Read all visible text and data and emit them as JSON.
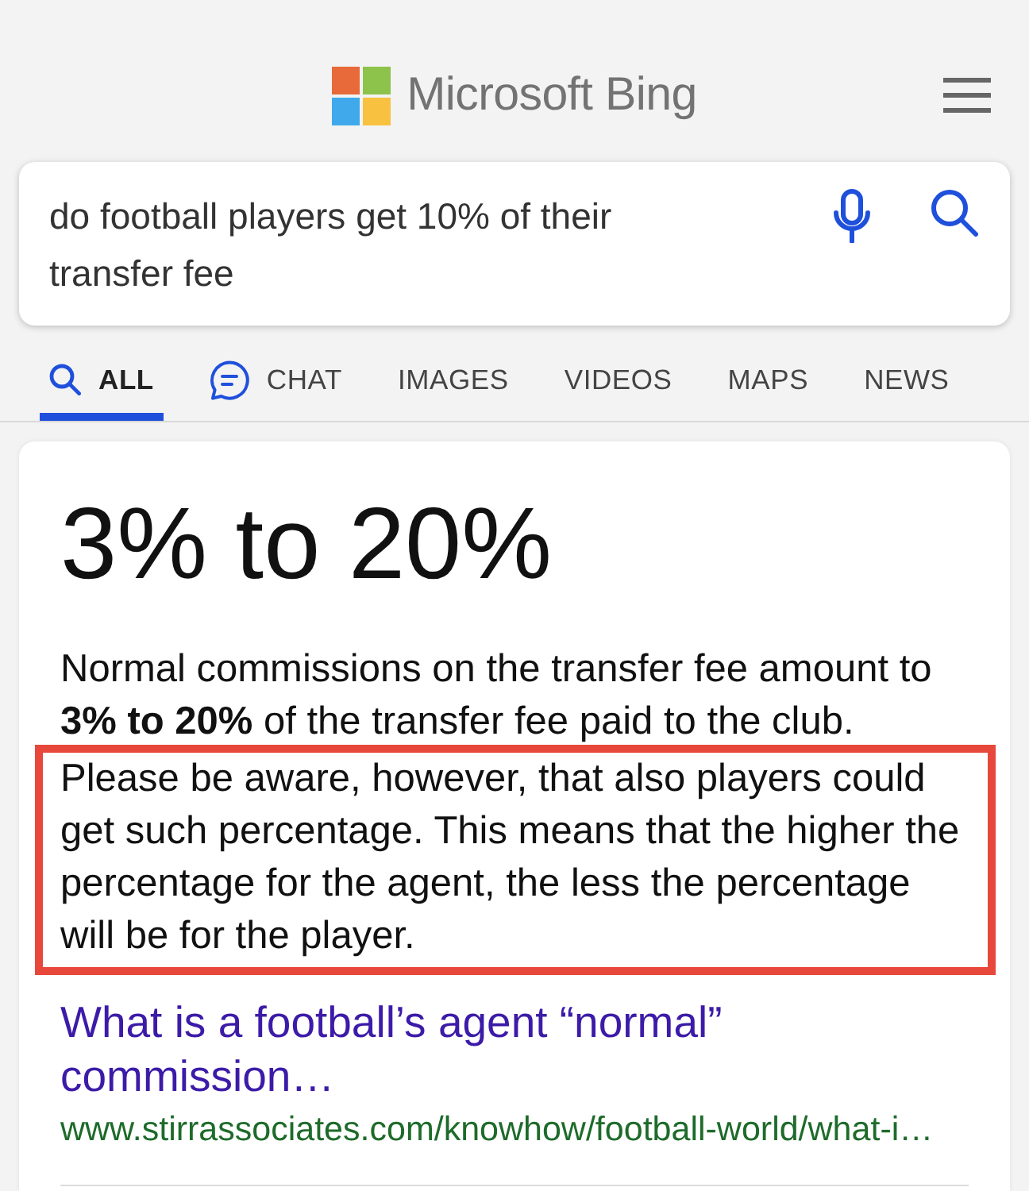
{
  "header": {
    "logo_text": "Microsoft Bing"
  },
  "search": {
    "value": "do football players get 10% of their transfer fee"
  },
  "tabs": [
    {
      "label": "ALL",
      "kind": "search",
      "selected": true
    },
    {
      "label": "CHAT",
      "kind": "chat",
      "selected": false
    },
    {
      "label": "IMAGES",
      "kind": "plain",
      "selected": false
    },
    {
      "label": "VIDEOS",
      "kind": "plain",
      "selected": false
    },
    {
      "label": "MAPS",
      "kind": "plain",
      "selected": false
    },
    {
      "label": "NEWS",
      "kind": "plain",
      "selected": false
    }
  ],
  "answer": {
    "title": "3% to 20%",
    "passages": [
      {
        "text": "Normal commissions on the transfer fee amount to **3% to 20%** of the transfer fee paid to the club.",
        "highlighted": false
      },
      {
        "text": "Please be aware, however, that also players could get such percentage. This means that the higher the percentage for the agent, the less the percentage will be for the player.",
        "highlighted": true
      }
    ]
  },
  "result": {
    "title": "What is a football’s agent “normal” commission…",
    "url": "www.stirrassociates.com/knowhow/football-world/what-i…"
  }
}
